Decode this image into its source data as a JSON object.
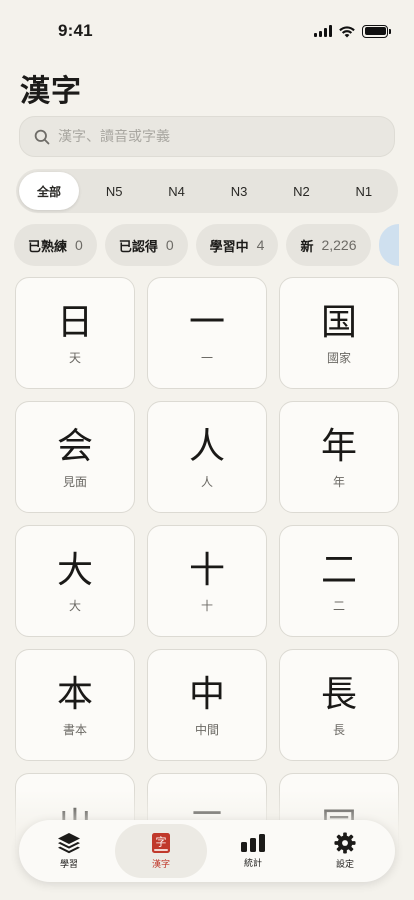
{
  "status": {
    "time": "9:41"
  },
  "header": {
    "title": "漢字"
  },
  "search": {
    "placeholder": "漢字、讀音或字義"
  },
  "levels": [
    {
      "label": "全部",
      "active": true
    },
    {
      "label": "N5"
    },
    {
      "label": "N4"
    },
    {
      "label": "N3"
    },
    {
      "label": "N2"
    },
    {
      "label": "N1"
    }
  ],
  "stats": [
    {
      "label": "已熟練",
      "value": "0"
    },
    {
      "label": "已認得",
      "value": "0"
    },
    {
      "label": "學習中",
      "value": "4"
    },
    {
      "label": "新",
      "value": "2,226"
    }
  ],
  "kanji": [
    {
      "char": "日",
      "meaning": "天"
    },
    {
      "char": "一",
      "meaning": "一"
    },
    {
      "char": "国",
      "meaning": "國家"
    },
    {
      "char": "会",
      "meaning": "見面"
    },
    {
      "char": "人",
      "meaning": "人"
    },
    {
      "char": "年",
      "meaning": "年"
    },
    {
      "char": "大",
      "meaning": "大"
    },
    {
      "char": "十",
      "meaning": "十"
    },
    {
      "char": "二",
      "meaning": "二"
    },
    {
      "char": "本",
      "meaning": "書本"
    },
    {
      "char": "中",
      "meaning": "中間"
    },
    {
      "char": "長",
      "meaning": "長"
    },
    {
      "char": "出",
      "meaning": ""
    },
    {
      "char": "三",
      "meaning": ""
    },
    {
      "char": "同",
      "meaning": ""
    }
  ],
  "tabs": [
    {
      "label": "學習",
      "icon": "stack-icon"
    },
    {
      "label": "漢字",
      "icon": "kanji-book-icon",
      "active": true
    },
    {
      "label": "統計",
      "icon": "bar-chart-icon"
    },
    {
      "label": "設定",
      "icon": "gear-icon"
    }
  ],
  "colors": {
    "background": "#f4f2ec",
    "accent": "#c0392b",
    "card": "#fcfbf8"
  }
}
